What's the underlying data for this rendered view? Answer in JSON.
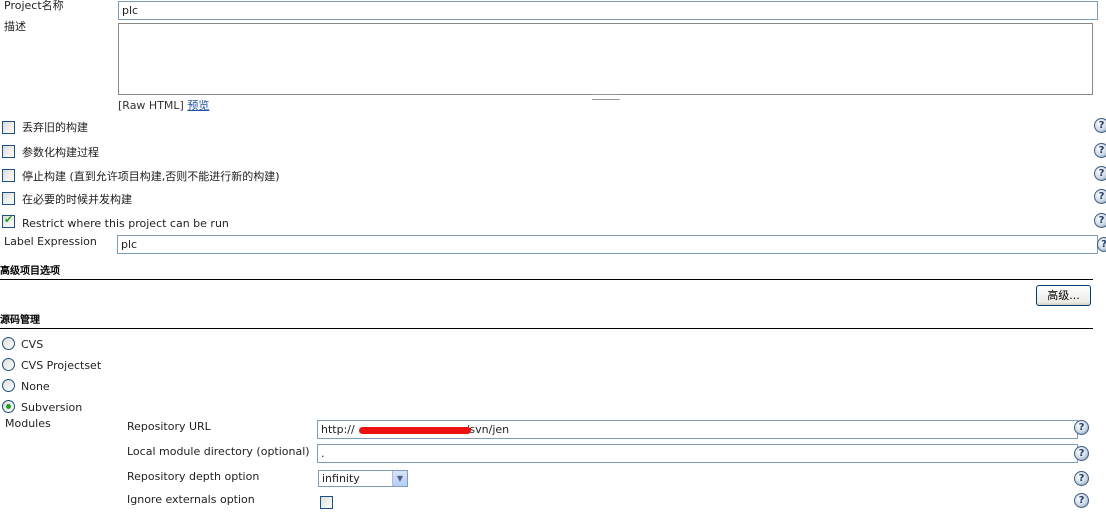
{
  "project": {
    "name_label": "Project名称",
    "name_value": "plc",
    "description_label": "描述",
    "description_value": "",
    "raw_html_label": "[Raw HTML]",
    "preview_link": "预览"
  },
  "options": [
    {
      "label": "丢弃旧的构建",
      "checked": false
    },
    {
      "label": "参数化构建过程",
      "checked": false
    },
    {
      "label": "停止构建 (直到允许项目构建,否则不能进行新的构建)",
      "checked": false
    },
    {
      "label": "在必要的时候并发构建",
      "checked": false
    },
    {
      "label": "Restrict where this project can be run",
      "checked": true
    }
  ],
  "label_expression": {
    "label": "Label Expression",
    "value": "plc"
  },
  "advanced_section": {
    "title": "高级项目选项",
    "button_label": "高级..."
  },
  "scm_section": {
    "title": "源码管理",
    "radios": [
      {
        "label": "CVS",
        "selected": false
      },
      {
        "label": "CVS Projectset",
        "selected": false
      },
      {
        "label": "None",
        "selected": false
      },
      {
        "label": "Subversion",
        "selected": true
      }
    ],
    "modules_label": "Modules",
    "repository_url_label": "Repository URL",
    "repository_url_prefix": "http://",
    "repository_url_suffix": "/svn/jen",
    "local_module_label": "Local module directory (optional)",
    "local_module_value": ".",
    "depth_label": "Repository depth option",
    "depth_value": "infinity",
    "ignore_externals_label": "Ignore externals option",
    "ignore_externals_checked": false
  },
  "help_icon_text": "?",
  "colors": {
    "input_border": "#7f9db9",
    "link": "#2050a0",
    "check_green": "#21a121",
    "redaction": "#ee1111"
  }
}
